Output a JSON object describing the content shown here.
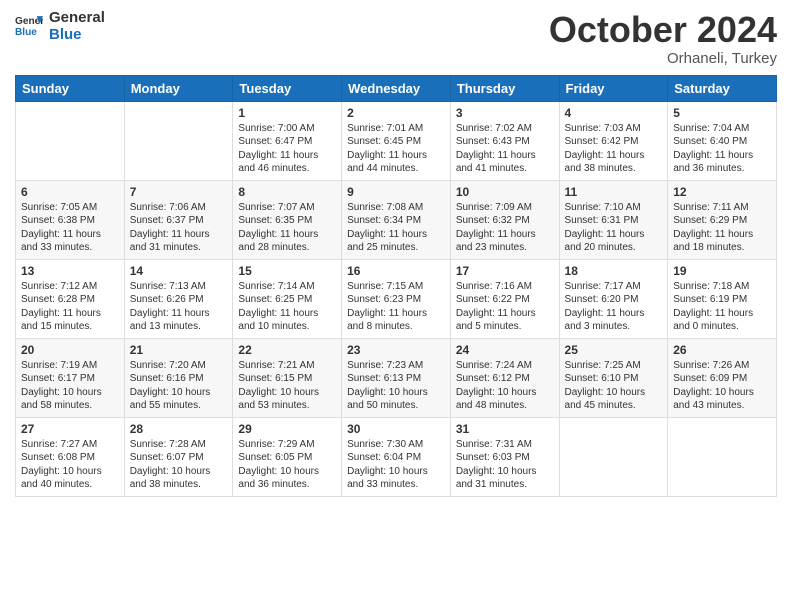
{
  "logo": {
    "line1": "General",
    "line2": "Blue"
  },
  "title": "October 2024",
  "subtitle": "Orhaneli, Turkey",
  "days_of_week": [
    "Sunday",
    "Monday",
    "Tuesday",
    "Wednesday",
    "Thursday",
    "Friday",
    "Saturday"
  ],
  "weeks": [
    [
      {
        "day": "",
        "sunrise": "",
        "sunset": "",
        "daylight": ""
      },
      {
        "day": "",
        "sunrise": "",
        "sunset": "",
        "daylight": ""
      },
      {
        "day": "1",
        "sunrise": "Sunrise: 7:00 AM",
        "sunset": "Sunset: 6:47 PM",
        "daylight": "Daylight: 11 hours and 46 minutes."
      },
      {
        "day": "2",
        "sunrise": "Sunrise: 7:01 AM",
        "sunset": "Sunset: 6:45 PM",
        "daylight": "Daylight: 11 hours and 44 minutes."
      },
      {
        "day": "3",
        "sunrise": "Sunrise: 7:02 AM",
        "sunset": "Sunset: 6:43 PM",
        "daylight": "Daylight: 11 hours and 41 minutes."
      },
      {
        "day": "4",
        "sunrise": "Sunrise: 7:03 AM",
        "sunset": "Sunset: 6:42 PM",
        "daylight": "Daylight: 11 hours and 38 minutes."
      },
      {
        "day": "5",
        "sunrise": "Sunrise: 7:04 AM",
        "sunset": "Sunset: 6:40 PM",
        "daylight": "Daylight: 11 hours and 36 minutes."
      }
    ],
    [
      {
        "day": "6",
        "sunrise": "Sunrise: 7:05 AM",
        "sunset": "Sunset: 6:38 PM",
        "daylight": "Daylight: 11 hours and 33 minutes."
      },
      {
        "day": "7",
        "sunrise": "Sunrise: 7:06 AM",
        "sunset": "Sunset: 6:37 PM",
        "daylight": "Daylight: 11 hours and 31 minutes."
      },
      {
        "day": "8",
        "sunrise": "Sunrise: 7:07 AM",
        "sunset": "Sunset: 6:35 PM",
        "daylight": "Daylight: 11 hours and 28 minutes."
      },
      {
        "day": "9",
        "sunrise": "Sunrise: 7:08 AM",
        "sunset": "Sunset: 6:34 PM",
        "daylight": "Daylight: 11 hours and 25 minutes."
      },
      {
        "day": "10",
        "sunrise": "Sunrise: 7:09 AM",
        "sunset": "Sunset: 6:32 PM",
        "daylight": "Daylight: 11 hours and 23 minutes."
      },
      {
        "day": "11",
        "sunrise": "Sunrise: 7:10 AM",
        "sunset": "Sunset: 6:31 PM",
        "daylight": "Daylight: 11 hours and 20 minutes."
      },
      {
        "day": "12",
        "sunrise": "Sunrise: 7:11 AM",
        "sunset": "Sunset: 6:29 PM",
        "daylight": "Daylight: 11 hours and 18 minutes."
      }
    ],
    [
      {
        "day": "13",
        "sunrise": "Sunrise: 7:12 AM",
        "sunset": "Sunset: 6:28 PM",
        "daylight": "Daylight: 11 hours and 15 minutes."
      },
      {
        "day": "14",
        "sunrise": "Sunrise: 7:13 AM",
        "sunset": "Sunset: 6:26 PM",
        "daylight": "Daylight: 11 hours and 13 minutes."
      },
      {
        "day": "15",
        "sunrise": "Sunrise: 7:14 AM",
        "sunset": "Sunset: 6:25 PM",
        "daylight": "Daylight: 11 hours and 10 minutes."
      },
      {
        "day": "16",
        "sunrise": "Sunrise: 7:15 AM",
        "sunset": "Sunset: 6:23 PM",
        "daylight": "Daylight: 11 hours and 8 minutes."
      },
      {
        "day": "17",
        "sunrise": "Sunrise: 7:16 AM",
        "sunset": "Sunset: 6:22 PM",
        "daylight": "Daylight: 11 hours and 5 minutes."
      },
      {
        "day": "18",
        "sunrise": "Sunrise: 7:17 AM",
        "sunset": "Sunset: 6:20 PM",
        "daylight": "Daylight: 11 hours and 3 minutes."
      },
      {
        "day": "19",
        "sunrise": "Sunrise: 7:18 AM",
        "sunset": "Sunset: 6:19 PM",
        "daylight": "Daylight: 11 hours and 0 minutes."
      }
    ],
    [
      {
        "day": "20",
        "sunrise": "Sunrise: 7:19 AM",
        "sunset": "Sunset: 6:17 PM",
        "daylight": "Daylight: 10 hours and 58 minutes."
      },
      {
        "day": "21",
        "sunrise": "Sunrise: 7:20 AM",
        "sunset": "Sunset: 6:16 PM",
        "daylight": "Daylight: 10 hours and 55 minutes."
      },
      {
        "day": "22",
        "sunrise": "Sunrise: 7:21 AM",
        "sunset": "Sunset: 6:15 PM",
        "daylight": "Daylight: 10 hours and 53 minutes."
      },
      {
        "day": "23",
        "sunrise": "Sunrise: 7:23 AM",
        "sunset": "Sunset: 6:13 PM",
        "daylight": "Daylight: 10 hours and 50 minutes."
      },
      {
        "day": "24",
        "sunrise": "Sunrise: 7:24 AM",
        "sunset": "Sunset: 6:12 PM",
        "daylight": "Daylight: 10 hours and 48 minutes."
      },
      {
        "day": "25",
        "sunrise": "Sunrise: 7:25 AM",
        "sunset": "Sunset: 6:10 PM",
        "daylight": "Daylight: 10 hours and 45 minutes."
      },
      {
        "day": "26",
        "sunrise": "Sunrise: 7:26 AM",
        "sunset": "Sunset: 6:09 PM",
        "daylight": "Daylight: 10 hours and 43 minutes."
      }
    ],
    [
      {
        "day": "27",
        "sunrise": "Sunrise: 7:27 AM",
        "sunset": "Sunset: 6:08 PM",
        "daylight": "Daylight: 10 hours and 40 minutes."
      },
      {
        "day": "28",
        "sunrise": "Sunrise: 7:28 AM",
        "sunset": "Sunset: 6:07 PM",
        "daylight": "Daylight: 10 hours and 38 minutes."
      },
      {
        "day": "29",
        "sunrise": "Sunrise: 7:29 AM",
        "sunset": "Sunset: 6:05 PM",
        "daylight": "Daylight: 10 hours and 36 minutes."
      },
      {
        "day": "30",
        "sunrise": "Sunrise: 7:30 AM",
        "sunset": "Sunset: 6:04 PM",
        "daylight": "Daylight: 10 hours and 33 minutes."
      },
      {
        "day": "31",
        "sunrise": "Sunrise: 7:31 AM",
        "sunset": "Sunset: 6:03 PM",
        "daylight": "Daylight: 10 hours and 31 minutes."
      },
      {
        "day": "",
        "sunrise": "",
        "sunset": "",
        "daylight": ""
      },
      {
        "day": "",
        "sunrise": "",
        "sunset": "",
        "daylight": ""
      }
    ]
  ]
}
